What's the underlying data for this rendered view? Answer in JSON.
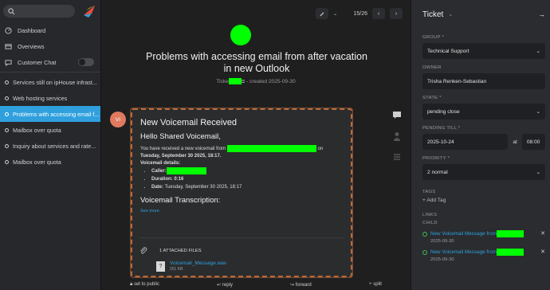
{
  "nav": {
    "items": [
      {
        "label": "Dashboard",
        "icon": "dashboard-icon"
      },
      {
        "label": "Overviews",
        "icon": "overviews-icon"
      },
      {
        "label": "Customer Chat",
        "icon": "chat-icon"
      }
    ],
    "tickets": [
      {
        "label": "Services still on ipHouse infrast..."
      },
      {
        "label": "Web hosting services"
      },
      {
        "label": "Problems with accessing email f..."
      },
      {
        "label": "Mailbox over quota"
      },
      {
        "label": "Inquiry about services and rate..."
      },
      {
        "label": "Mailbox over quota"
      }
    ],
    "active_index": 2
  },
  "topbar": {
    "pagination": "15/26"
  },
  "ticket": {
    "title": "Problems with accessing email from after vacation in new Outlook",
    "meta_prefix": "Ticke",
    "meta_suffix": "- created 2025-09-30"
  },
  "article": {
    "avatar_initials": "VI",
    "heading": "New Voicemail Received",
    "greeting": "Hello Shared Voicemail,",
    "intro_a": "You have received a new voicemail from",
    "intro_b": "on",
    "intro_date": "Tuesday, September 30 2025, 18:17.",
    "details_label": "Voicemail details:",
    "caller_label": "Caller:",
    "duration": "Duration: 0:16",
    "date_label": "Date:",
    "date_value": "Tuesday, September 30 2025, 18:17",
    "transcription": "Voicemail Transcription:",
    "see_more": "See more",
    "attached_label": "1 ATTACHED FILES",
    "attachment_name": "Voicemail_Message.wav",
    "attachment_size": "251 KB"
  },
  "bottombar": {
    "set_public": "set to public",
    "reply": "reply",
    "forward": "forward",
    "split": "split"
  },
  "sidebar": {
    "title": "Ticket",
    "group_label": "GROUP *",
    "group_value": "Technical Support",
    "owner_label": "OWNER",
    "owner_value": "Trisha Renken-Sebastian",
    "state_label": "STATE *",
    "state_value": "pending close",
    "pending_label": "PENDING TILL *",
    "pending_date": "2025-10-24",
    "at": "at",
    "pending_time": "08:00",
    "priority_label": "PRIORITY *",
    "priority_value": "2 normal",
    "tags_label": "TAGS",
    "add_tag": "+ Add Tag",
    "links_label": "LINKS",
    "child_label": "CHILD",
    "links": [
      {
        "label": "New Voicemail Message from",
        "date": "2025-09-30"
      },
      {
        "label": "New Voicemail Message from",
        "date": "2025-09-30"
      }
    ]
  }
}
